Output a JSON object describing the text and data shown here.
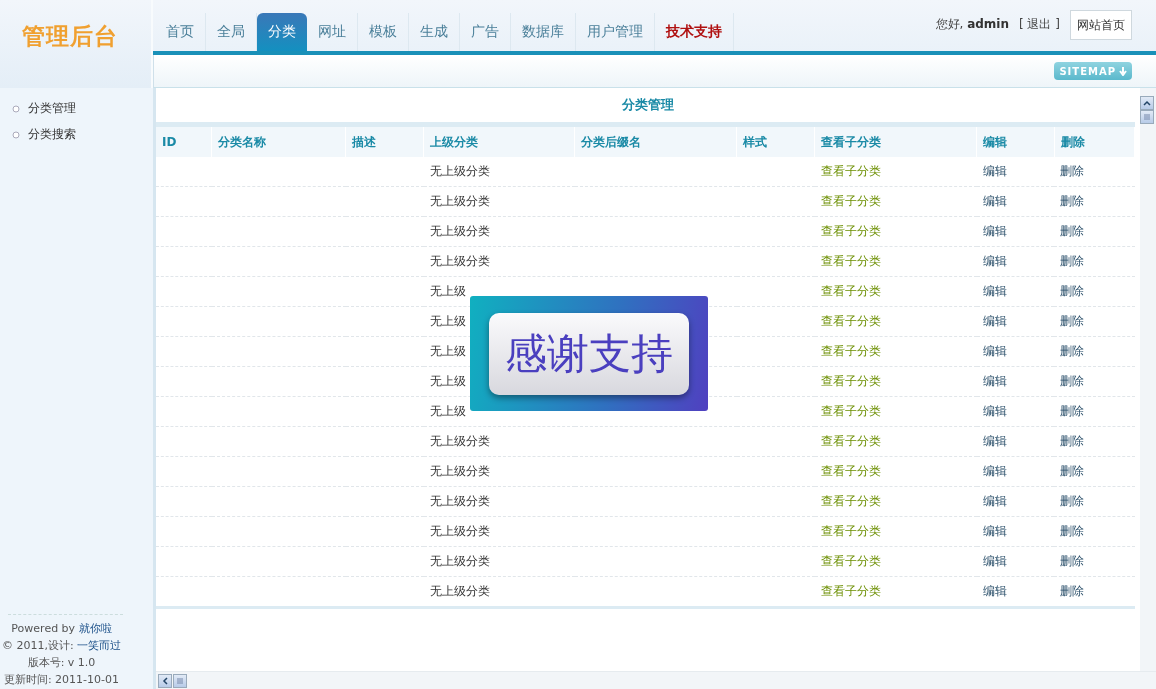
{
  "logo": "管理后台",
  "tabs": [
    {
      "label": "首页",
      "selected": false,
      "kind": "normal"
    },
    {
      "label": "全局",
      "selected": false,
      "kind": "normal"
    },
    {
      "label": "分类",
      "selected": true,
      "kind": "normal"
    },
    {
      "label": "网址",
      "selected": false,
      "kind": "normal"
    },
    {
      "label": "模板",
      "selected": false,
      "kind": "normal"
    },
    {
      "label": "生成",
      "selected": false,
      "kind": "normal"
    },
    {
      "label": "广告",
      "selected": false,
      "kind": "normal"
    },
    {
      "label": "数据库",
      "selected": false,
      "kind": "normal"
    },
    {
      "label": "用户管理",
      "selected": false,
      "kind": "normal"
    },
    {
      "label": "技术支持",
      "selected": false,
      "kind": "alert"
    }
  ],
  "user": {
    "greeting": "您好, **admin**",
    "logout": "[ 退出 ]",
    "home_button": "网站首页"
  },
  "sitemap_button": "SITEMAP",
  "sidebar": {
    "items": [
      {
        "label": "分类管理"
      },
      {
        "label": "分类搜索"
      }
    ],
    "footer": [
      {
        "text": "Powered by",
        "link": "就你啦"
      },
      {
        "text": "© 2011,设计:",
        "link": "一笑而过"
      },
      {
        "text": "版本号: v 1.0"
      },
      {
        "text": "更新时间: 2011-10-01"
      }
    ]
  },
  "panel": {
    "title": "分类管理",
    "table": {
      "columns": [
        "ID",
        "分类名称",
        "描述",
        "上级分类",
        "分类后缀名",
        "样式",
        "查看子分类",
        "编辑",
        "删除"
      ],
      "rows": [
        {
          "parent": "无上级分类",
          "view": "查看子分类",
          "edit": "编辑",
          "delete": "删除"
        },
        {
          "parent": "无上级分类",
          "view": "查看子分类",
          "edit": "编辑",
          "delete": "删除"
        },
        {
          "parent": "无上级分类",
          "view": "查看子分类",
          "edit": "编辑",
          "delete": "删除"
        },
        {
          "parent": "无上级分类",
          "view": "查看子分类",
          "edit": "编辑",
          "delete": "删除"
        },
        {
          "parent": "无上级",
          "view": "查看子分类",
          "edit": "编辑",
          "delete": "删除"
        },
        {
          "parent": "无上级",
          "view": "查看子分类",
          "edit": "编辑",
          "delete": "删除"
        },
        {
          "parent": "无上级",
          "view": "查看子分类",
          "edit": "编辑",
          "delete": "删除"
        },
        {
          "parent": "无上级",
          "view": "查看子分类",
          "edit": "编辑",
          "delete": "删除"
        },
        {
          "parent": "无上级",
          "view": "查看子分类",
          "edit": "编辑",
          "delete": "删除"
        },
        {
          "parent": "无上级分类",
          "view": "查看子分类",
          "edit": "编辑",
          "delete": "删除"
        },
        {
          "parent": "无上级分类",
          "view": "查看子分类",
          "edit": "编辑",
          "delete": "删除"
        },
        {
          "parent": "无上级分类",
          "view": "查看子分类",
          "edit": "编辑",
          "delete": "删除"
        },
        {
          "parent": "无上级分类",
          "view": "查看子分类",
          "edit": "编辑",
          "delete": "删除"
        },
        {
          "parent": "无上级分类",
          "view": "查看子分类",
          "edit": "编辑",
          "delete": "删除"
        },
        {
          "parent": "无上级分类",
          "view": "查看子分类",
          "edit": "编辑",
          "delete": "删除"
        }
      ]
    }
  },
  "banner": {
    "text": "感谢支持"
  }
}
